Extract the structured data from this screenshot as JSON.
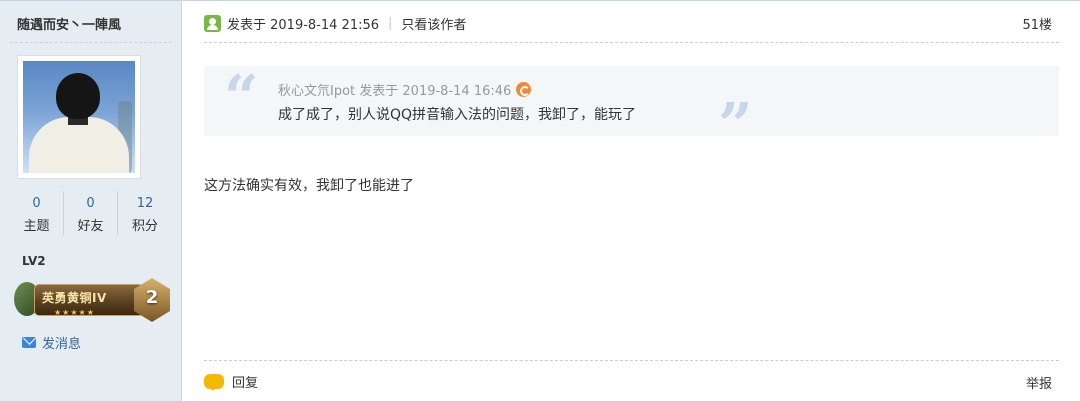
{
  "author": {
    "name": "随遇而安丶一陣風",
    "stats": [
      {
        "value": "0",
        "label": "主题"
      },
      {
        "value": "0",
        "label": "好友"
      },
      {
        "value": "12",
        "label": "积分"
      }
    ],
    "level": "LV2",
    "badge": {
      "title": "英勇黄铜IV",
      "tier": "2",
      "stars": "★★★★★"
    },
    "send_message": "发消息"
  },
  "post": {
    "meta": {
      "posted_at": "发表于 2019-8-14 21:56",
      "author_only": "只看该作者",
      "separator": "|"
    },
    "floor": "51楼",
    "quote": {
      "open_mark": "“",
      "close_mark": "”",
      "header": "秋心文氘Ipot 发表于 2019-8-14 16:46",
      "body": "成了成了，别人说QQ拼音输入法的问题，我卸了，能玩了"
    },
    "body": "这方法确实有效，我卸了也能进了",
    "actions": {
      "reply": "回复",
      "report": "举报"
    }
  },
  "colors": {
    "sidebar_bg": "#e5edf2",
    "link": "#336699",
    "quote_bg": "#f5f6f7",
    "quote_mark": "#c7d6e8"
  }
}
